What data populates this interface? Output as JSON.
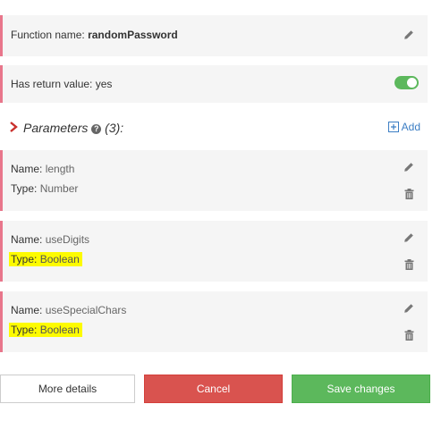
{
  "function": {
    "name_label": "Function name:",
    "name_value": "randomPassword"
  },
  "return_value": {
    "label": "Has return value:",
    "value": "yes",
    "enabled": true
  },
  "parameters": {
    "title": "Parameters",
    "count_text": "(3):",
    "add_label": "Add",
    "items": [
      {
        "name_label": "Name:",
        "name": "length",
        "type_label": "Type:",
        "type": "Number",
        "highlighted": false
      },
      {
        "name_label": "Name:",
        "name": "useDigits",
        "type_label": "Type:",
        "type": "Boolean",
        "highlighted": true
      },
      {
        "name_label": "Name:",
        "name": "useSpecialChars",
        "type_label": "Type:",
        "type": "Boolean",
        "highlighted": true
      }
    ]
  },
  "buttons": {
    "more_details": "More details",
    "cancel": "Cancel",
    "save": "Save changes"
  },
  "colors": {
    "accent_border": "#e8768b",
    "toggle_on": "#5cb85c",
    "cancel": "#d9534f",
    "save": "#5cb85c",
    "link": "#3c7ec4",
    "highlight": "#fdfb00"
  },
  "icons": {
    "edit": "pencil-icon",
    "delete": "trash-icon",
    "expand": "chevron-right-icon",
    "help": "question-circle-icon",
    "add": "plus-square-icon"
  }
}
